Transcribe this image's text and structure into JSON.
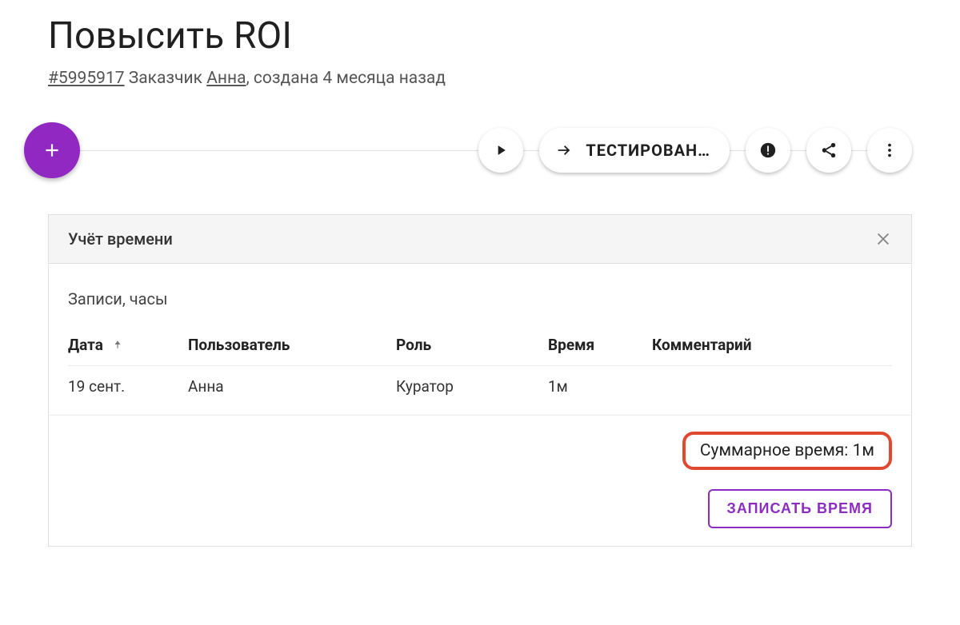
{
  "header": {
    "title": "Повысить ROI",
    "ticket_id": "#5995917",
    "client_prefix": "Заказчик",
    "client_name": "Анна",
    "created_suffix": ", создана 4 месяца назад"
  },
  "toolbar": {
    "status_label": "ТЕСТИРОВАН…"
  },
  "panel": {
    "title": "Учёт времени",
    "section": "Записи, часы",
    "columns": {
      "date": "Дата",
      "user": "Пользователь",
      "role": "Роль",
      "time": "Время",
      "comment": "Комментарий"
    },
    "rows": [
      {
        "date": "19 сент.",
        "user": "Анна",
        "role": "Куратор",
        "time": "1м",
        "comment": ""
      }
    ],
    "total_label": "Суммарное время:",
    "total_value": "1м",
    "record_button": "ЗАПИСАТЬ ВРЕМЯ"
  }
}
